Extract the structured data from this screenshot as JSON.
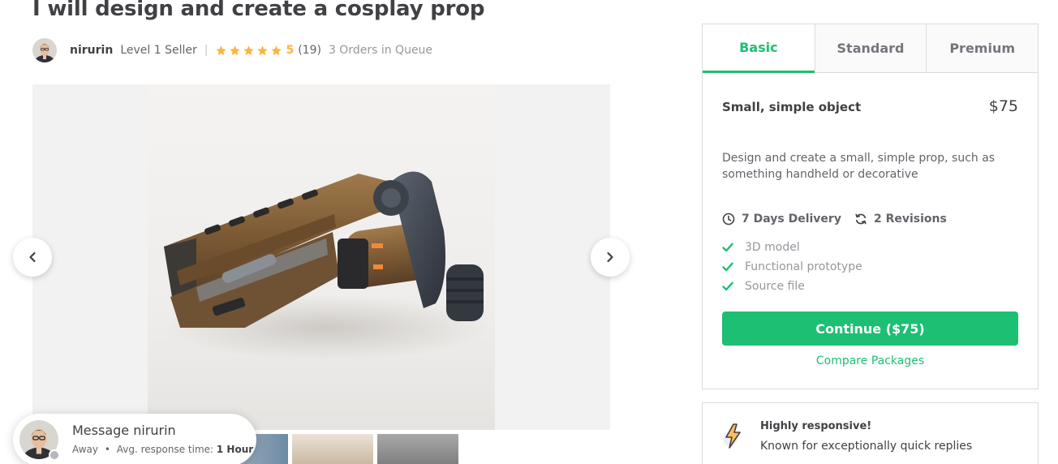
{
  "gig": {
    "title": "I will design and create a cosplay prop"
  },
  "seller": {
    "username": "nirurin",
    "level": "Level 1 Seller",
    "separator": "|",
    "rating": "5",
    "reviews": "(19)",
    "orders_in_queue": "3 Orders in Queue",
    "star_count": 5,
    "star_color": "#ffb33e"
  },
  "gallery": {
    "prev_icon": "chevron-left-icon",
    "next_icon": "chevron-right-icon",
    "thumbnail_count": 3
  },
  "message": {
    "title": "Message nirurin",
    "status": "Away",
    "dot": "•",
    "response_label": "Avg. response time:",
    "response_value": "1 Hour"
  },
  "packages": {
    "tabs": [
      "Basic",
      "Standard",
      "Premium"
    ],
    "active_tab": "Basic",
    "basic": {
      "title": "Small, simple object",
      "price": "$75",
      "description": "Design and create a small, simple prop, such as something handheld or decorative",
      "delivery": "7 Days Delivery",
      "revisions": "2 Revisions",
      "features": [
        "3D model",
        "Functional prototype",
        "Source file"
      ],
      "continue_label": "Continue ($75)",
      "compare_label": "Compare Packages"
    }
  },
  "highlight": {
    "title": "Highly responsive!",
    "text": "Known for exceptionally quick replies",
    "icon": "lightning-bolt-icon"
  },
  "colors": {
    "accent": "#1dbf73",
    "star": "#ffb33e",
    "text": "#404145",
    "muted": "#62646a"
  }
}
